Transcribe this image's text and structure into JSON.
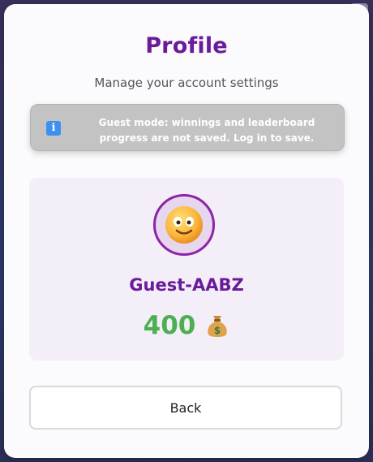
{
  "profile": {
    "title": "Profile",
    "subtitle": "Manage your account settings"
  },
  "notice": {
    "icon": "info-icon",
    "icon_glyph": "i",
    "text": "Guest mode: winnings and leaderboard progress are not saved. Log in to save."
  },
  "user": {
    "avatar": "smiling-face-emoji",
    "name": "Guest-AABZ",
    "balance": "400",
    "balance_icon": "money-bag-icon"
  },
  "actions": {
    "back_label": "Back"
  },
  "colors": {
    "title": "#6a1b9a",
    "balance": "#4caf50",
    "notice_bg": "#c3c3c3",
    "panel_bg": "#f3eef7"
  }
}
